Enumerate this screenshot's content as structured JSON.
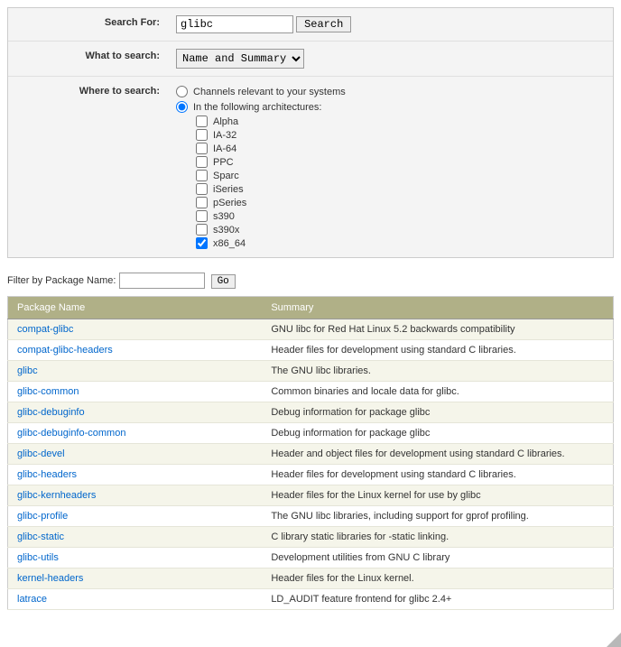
{
  "form": {
    "searchFor": {
      "label": "Search For:",
      "value": "glibc",
      "button": "Search"
    },
    "whatToSearch": {
      "label": "What to search:",
      "selected": "Name and Summary"
    },
    "whereToSearch": {
      "label": "Where to search:",
      "radio1": "Channels relevant to your systems",
      "radio2": "In the following architectures:",
      "selected": "arch",
      "archs": [
        {
          "label": "Alpha",
          "checked": false
        },
        {
          "label": "IA-32",
          "checked": false
        },
        {
          "label": "IA-64",
          "checked": false
        },
        {
          "label": "PPC",
          "checked": false
        },
        {
          "label": "Sparc",
          "checked": false
        },
        {
          "label": "iSeries",
          "checked": false
        },
        {
          "label": "pSeries",
          "checked": false
        },
        {
          "label": "s390",
          "checked": false
        },
        {
          "label": "s390x",
          "checked": false
        },
        {
          "label": "x86_64",
          "checked": true
        }
      ]
    }
  },
  "filter": {
    "label": "Filter by Package Name:",
    "value": "",
    "button": "Go"
  },
  "table": {
    "headers": {
      "name": "Package Name",
      "summary": "Summary"
    },
    "rows": [
      {
        "name": "compat-glibc",
        "summary": "GNU libc for Red Hat Linux 5.2 backwards compatibility"
      },
      {
        "name": "compat-glibc-headers",
        "summary": "Header files for development using standard C libraries."
      },
      {
        "name": "glibc",
        "summary": "The GNU libc libraries."
      },
      {
        "name": "glibc-common",
        "summary": "Common binaries and locale data for glibc."
      },
      {
        "name": "glibc-debuginfo",
        "summary": "Debug information for package glibc"
      },
      {
        "name": "glibc-debuginfo-common",
        "summary": "Debug information for package glibc"
      },
      {
        "name": "glibc-devel",
        "summary": "Header and object files for development using standard C libraries."
      },
      {
        "name": "glibc-headers",
        "summary": "Header files for development using standard C libraries."
      },
      {
        "name": "glibc-kernheaders",
        "summary": "Header files for the Linux kernel for use by glibc"
      },
      {
        "name": "glibc-profile",
        "summary": "The GNU libc libraries, including support for gprof profiling."
      },
      {
        "name": "glibc-static",
        "summary": "C library static libraries for -static linking."
      },
      {
        "name": "glibc-utils",
        "summary": "Development utilities from GNU C library"
      },
      {
        "name": "kernel-headers",
        "summary": "Header files for the Linux kernel."
      },
      {
        "name": "latrace",
        "summary": "LD_AUDIT feature frontend for glibc 2.4+"
      }
    ]
  }
}
